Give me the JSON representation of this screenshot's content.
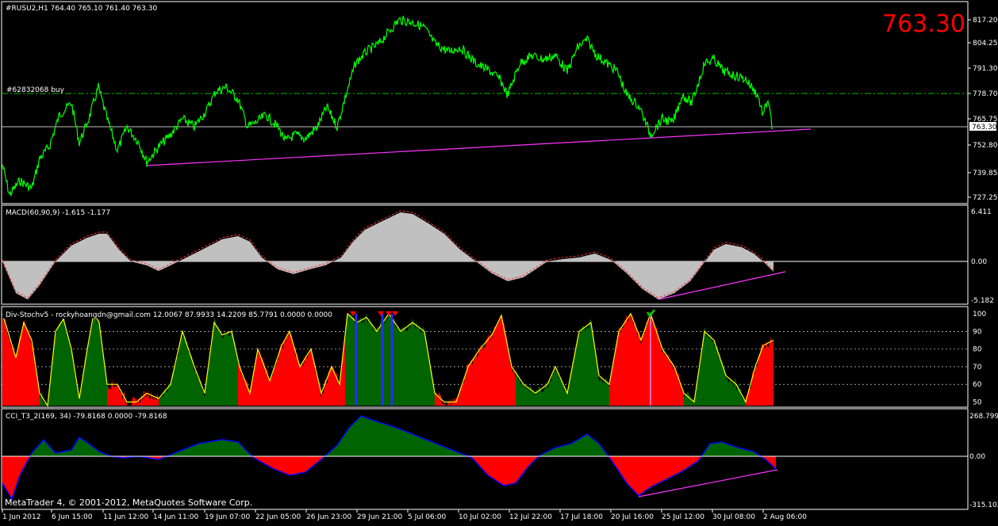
{
  "colors": {
    "background": "#000000",
    "price_line": "#00ff00",
    "trendline": "#ff33ff",
    "big_price": "#ff0000",
    "macd_hist": "#c0c0c0",
    "macd_signal": "#ff3333",
    "stoch_red": "#ff0000",
    "stoch_green": "#006400",
    "stoch_line_yellow": "#ffff00",
    "stoch_line_blue": "#2a2aff",
    "cci_green": "#006400",
    "cci_red": "#ff0000",
    "cci_line": "#0000ff",
    "grid": "#ffffff"
  },
  "main_pane": {
    "header": "#RUSU2,H1  764.40 765.10 761.40 763.30",
    "big_price": "763.30",
    "order_label": "#62832068 buy",
    "current_price_tag": "763.30",
    "price_axis": [
      "817.20",
      "804.25",
      "791.30",
      "778.70",
      "765.75",
      "752.80",
      "739.85",
      "727.25"
    ],
    "ylim": [
      727.25,
      817.2
    ]
  },
  "macd_pane": {
    "header": "MACD(60,90,9) -1.615 -1.177",
    "axis": [
      "6.411",
      "0.00",
      "-5.182"
    ],
    "ylim": [
      -5.182,
      6.411
    ]
  },
  "stoch_pane": {
    "header": "Div-Stochv5 - rockyhoangdn@gmail.com 12.0067 87.9933 14.2209 85.7791 0.0000 0.0000",
    "axis": [
      "100",
      "90",
      "80",
      "70",
      "60",
      "50"
    ],
    "ylim": [
      48,
      100
    ]
  },
  "cci_pane": {
    "header": "CCI_T3_2(169, 34) -79.8168 0.0000 -79.8168",
    "axis": [
      "268.799",
      "0.00",
      "-315.102"
    ],
    "ylim": [
      -315.102,
      268.799
    ]
  },
  "time_axis": [
    "1 Jun 2012",
    "6 Jun 15:00",
    "11 Jun 12:00",
    "14 Jun 11:00",
    "19 Jun 07:00",
    "22 Jun 05:00",
    "26 Jun 23:00",
    "29 Jun 21:00",
    "5 Jul 06:00",
    "10 Jul 02:00",
    "12 Jul 22:00",
    "17 Jul 18:00",
    "20 Jul 16:00",
    "25 Jul 12:00",
    "30 Jul 08:00",
    "2 Aug 06:00"
  ],
  "copyright": "MetaTrader 4, © 2001-2012, MetaQuotes Software Corp."
}
